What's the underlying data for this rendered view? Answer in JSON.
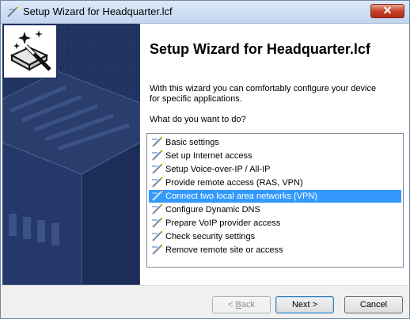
{
  "window": {
    "title": "Setup Wizard for Headquarter.lcf",
    "close_glyph": "✕"
  },
  "content": {
    "heading": "Setup Wizard for Headquarter.lcf",
    "intro": "With this wizard you can comfortably configure your device for specific applications.",
    "question": "What do you want to do?",
    "options": [
      {
        "label": "Basic settings",
        "selected": false
      },
      {
        "label": "Set up Internet access",
        "selected": false
      },
      {
        "label": "Setup Voice-over-IP / All-IP",
        "selected": false
      },
      {
        "label": "Provide remote access (RAS, VPN)",
        "selected": false
      },
      {
        "label": "Connect two local area networks (VPN)",
        "selected": true
      },
      {
        "label": "Configure Dynamic DNS",
        "selected": false
      },
      {
        "label": "Prepare VoIP provider access",
        "selected": false
      },
      {
        "label": "Check security settings",
        "selected": false
      },
      {
        "label": "Remove remote site or access",
        "selected": false
      }
    ]
  },
  "buttons": {
    "back": "< Back",
    "back_mnemonic": "B",
    "next": "Next >",
    "cancel": "Cancel"
  },
  "icons": {
    "title": "wand-icon",
    "option": "wand-icon",
    "logo": "wizard-wand-logo-icon"
  },
  "colors": {
    "sidebar": "#20325f",
    "selection": "#3399ff",
    "close": "#c7432c"
  }
}
